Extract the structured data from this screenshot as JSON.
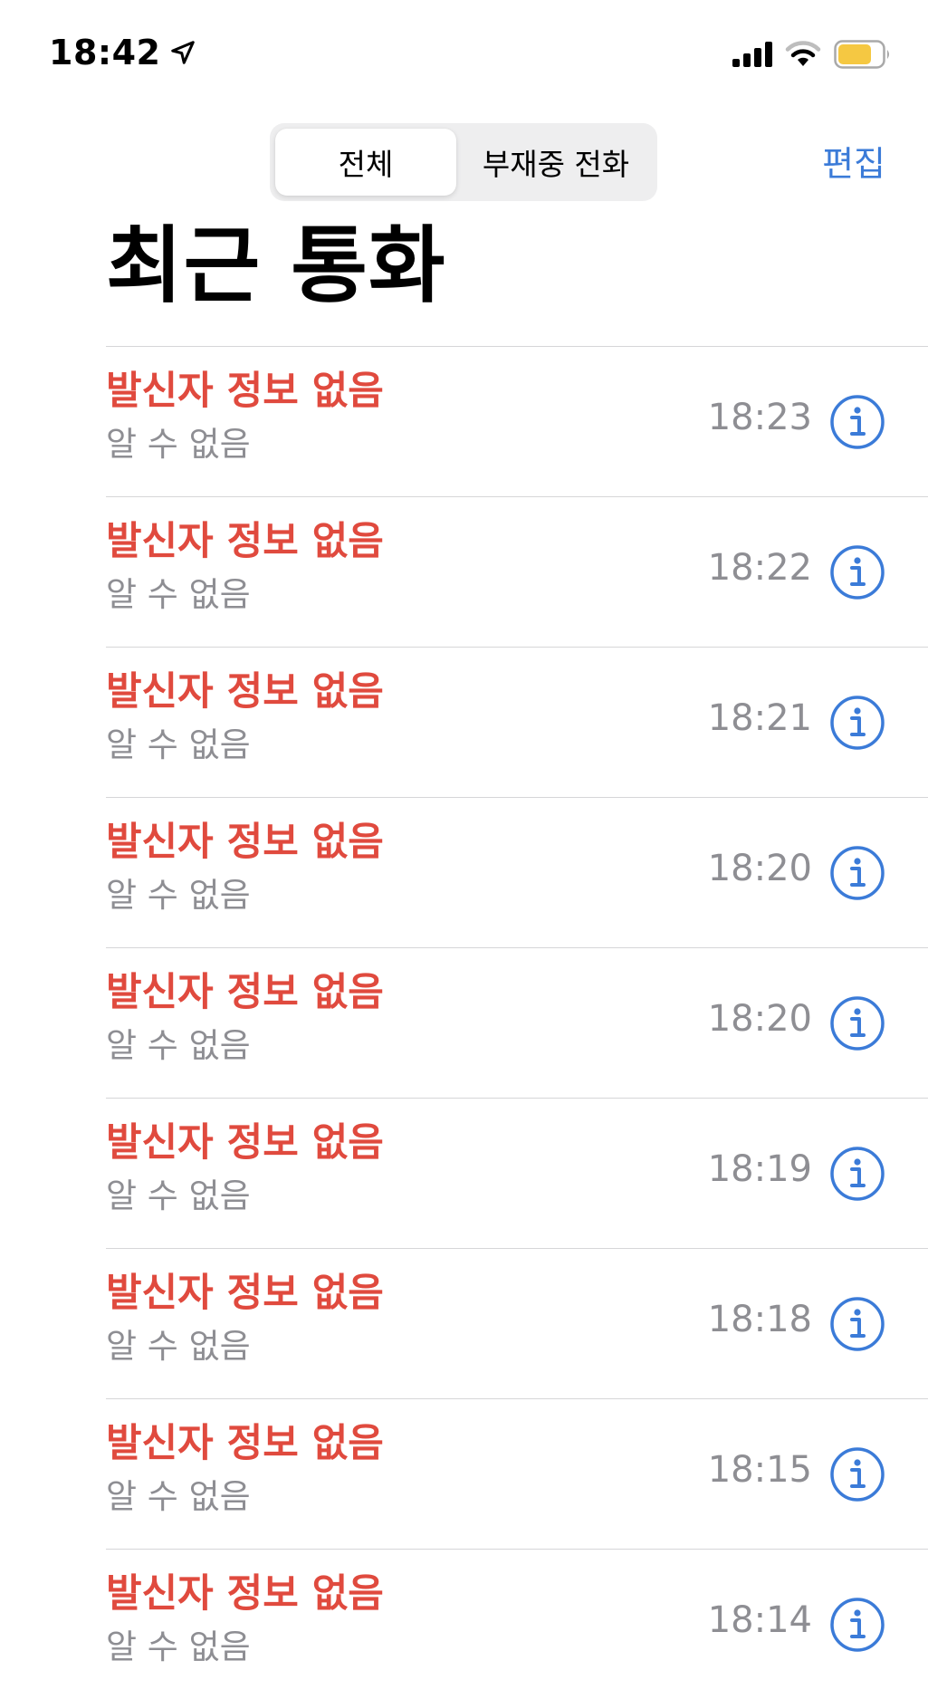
{
  "status_bar": {
    "time": "18:42",
    "icons": [
      "location-arrow-icon",
      "cellular-signal-icon",
      "wifi-icon",
      "battery-icon"
    ],
    "battery_color": "#f5c842"
  },
  "header": {
    "segments": [
      {
        "label": "전체",
        "selected": true
      },
      {
        "label": "부재중 전화",
        "selected": false
      }
    ],
    "edit_label": "편집",
    "accent_color": "#3b7bd8"
  },
  "title": "최근 통화",
  "calls": [
    {
      "name": "발신자 정보 없음",
      "detail": "알 수 없음",
      "time": "18:23"
    },
    {
      "name": "발신자 정보 없음",
      "detail": "알 수 없음",
      "time": "18:22"
    },
    {
      "name": "발신자 정보 없음",
      "detail": "알 수 없음",
      "time": "18:21"
    },
    {
      "name": "발신자 정보 없음",
      "detail": "알 수 없음",
      "time": "18:20"
    },
    {
      "name": "발신자 정보 없음",
      "detail": "알 수 없음",
      "time": "18:20"
    },
    {
      "name": "발신자 정보 없음",
      "detail": "알 수 없음",
      "time": "18:19"
    },
    {
      "name": "발신자 정보 없음",
      "detail": "알 수 없음",
      "time": "18:18"
    },
    {
      "name": "발신자 정보 없음",
      "detail": "알 수 없음",
      "time": "18:15"
    },
    {
      "name": "발신자 정보 없음",
      "detail": "알 수 없음",
      "time": "18:14"
    }
  ],
  "colors": {
    "missed_call_red": "#e04a3e",
    "secondary_gray": "#8e8e93",
    "info_blue": "#3b7bd8"
  }
}
